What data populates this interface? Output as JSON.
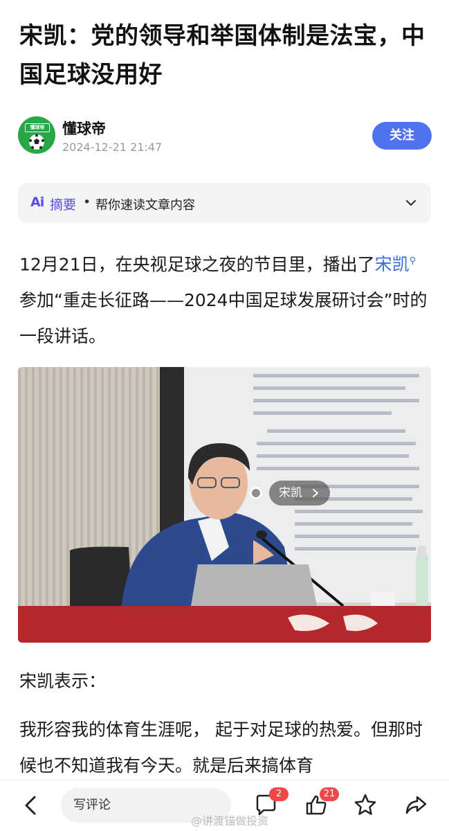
{
  "article": {
    "title": "宋凯：党的领导和举国体制是法宝，中国足球没用好"
  },
  "author": {
    "avatar_text": "懂球帝",
    "name": "懂球帝",
    "time": "2024-12-21 21:47",
    "follow_label": "关注"
  },
  "summary": {
    "ai_label": "Ai",
    "label": "摘要",
    "separator": "•",
    "description": "帮你速读文章内容"
  },
  "content": {
    "p1_before": "12月21日，在央视足球之夜的节目里，播出了",
    "p1_link": "宋凯",
    "p1_after": " 参加“重走长征路——2024中国足球发展研讨会”时的一段讲话。",
    "photo_tag": "宋凯",
    "p2": "宋凯表示：",
    "p3": "我形容我的体育生涯呢， 起于对足球的热爱。但那时候也不知道我有今天。就是后来搞体育"
  },
  "bottom_bar": {
    "comment_placeholder": "写评论",
    "comment_count": "2",
    "like_count": "21",
    "watermark": "@讲渡锚做投资"
  },
  "colors": {
    "accent": "#4f72f0",
    "link": "#3b6fd8",
    "badge": "#f04848",
    "avatar": "#27a745"
  },
  "icons": [
    "back-icon",
    "comment-icon",
    "like-icon",
    "star-icon",
    "share-icon",
    "chevron-down-icon",
    "football-icon"
  ]
}
